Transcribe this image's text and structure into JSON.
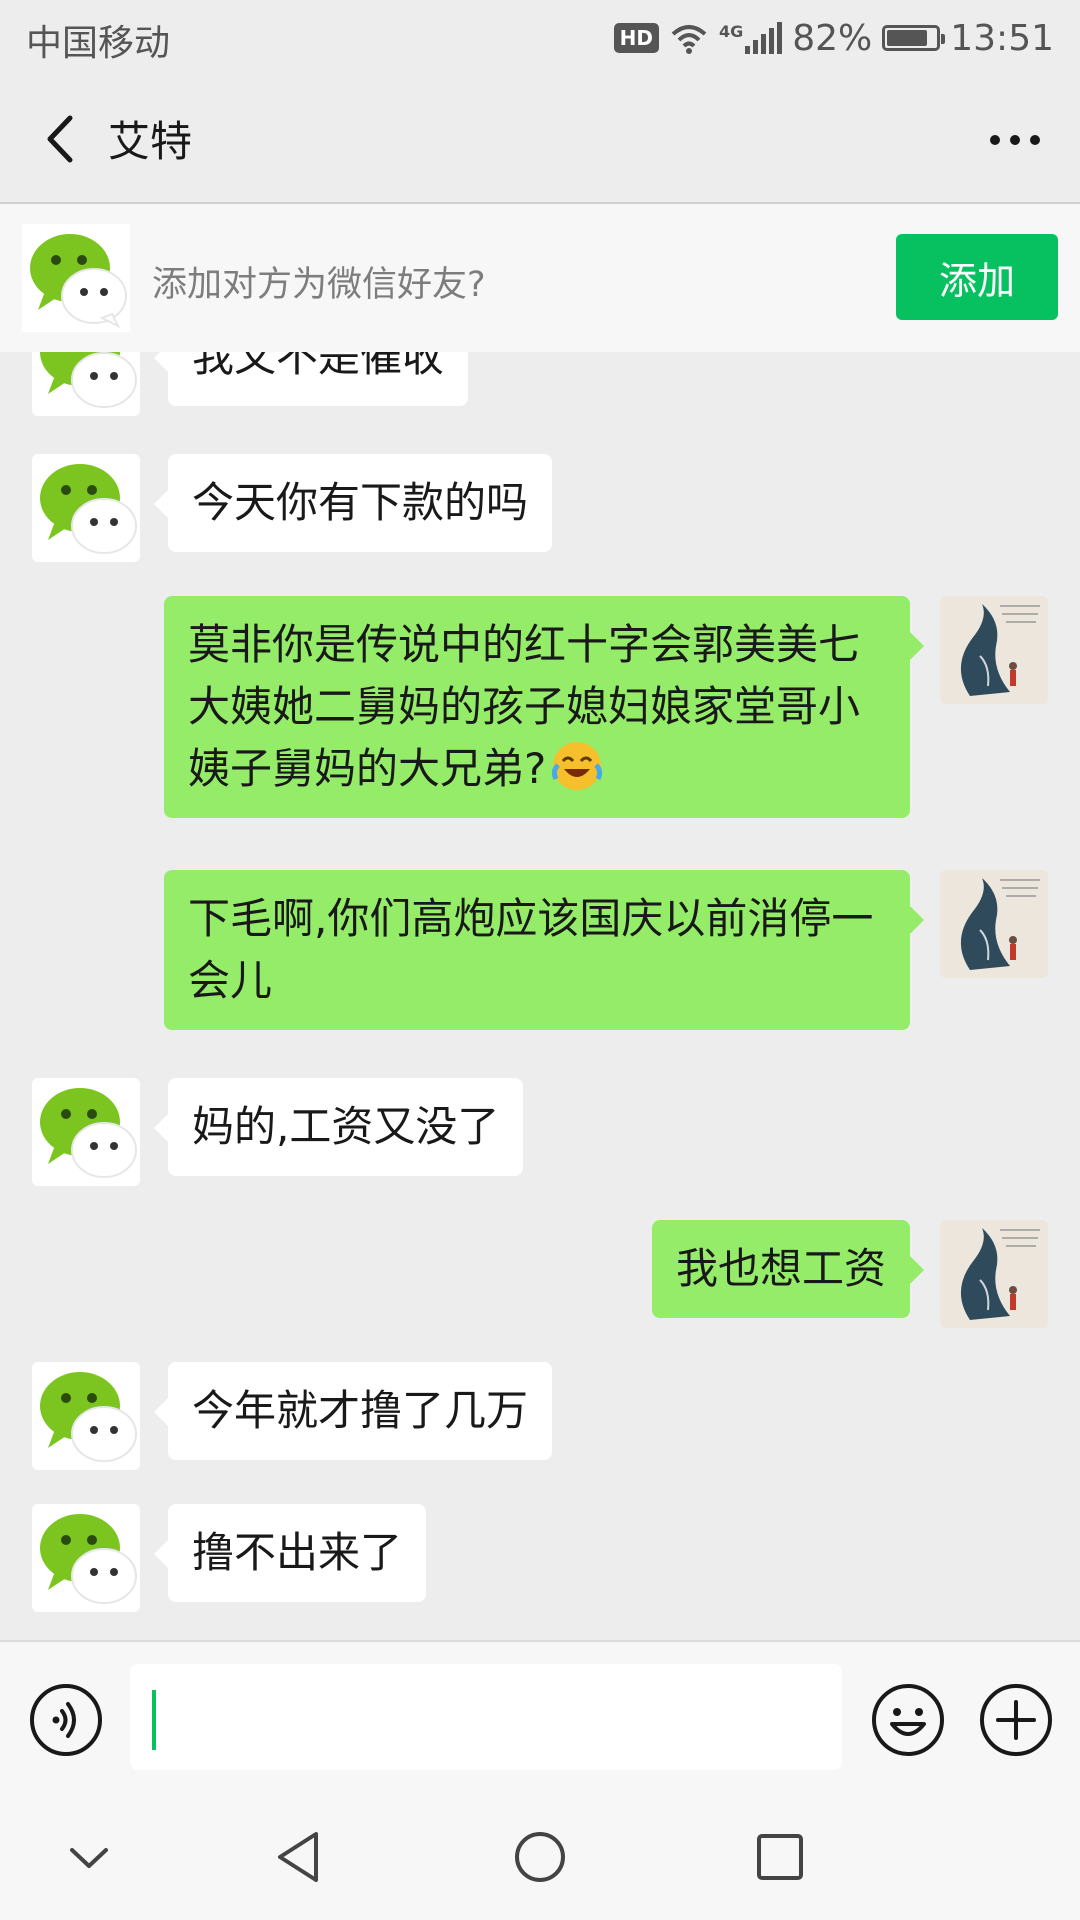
{
  "status_bar": {
    "carrier": "中国移动",
    "hd": "HD",
    "network": "4G",
    "battery_percent": "82%",
    "battery_level": 0.82,
    "time": "13:51"
  },
  "header": {
    "title": "艾特",
    "back_icon": "chevron-left-icon",
    "more_icon": "more-horizontal-icon"
  },
  "add_friend_banner": {
    "prompt": "添加对方为微信好友?",
    "button_label": "添加",
    "button_color": "#07c160"
  },
  "messages": [
    {
      "side": "left",
      "text": "我又不是催收"
    },
    {
      "side": "left",
      "text": "今天你有下款的吗"
    },
    {
      "side": "right",
      "text": "莫非你是传说中的红十字会郭美美七大姨她二舅妈的孩子媳妇娘家堂哥小姨子舅妈的大兄弟?",
      "emoji": "face-with-tears-of-joy"
    },
    {
      "side": "right",
      "text": "下毛啊,你们高炮应该国庆以前消停一会儿"
    },
    {
      "side": "left",
      "text": "妈的,工资又没了"
    },
    {
      "side": "right",
      "text": "我也想工资"
    },
    {
      "side": "left",
      "text": "今年就才撸了几万"
    },
    {
      "side": "left",
      "text": "撸不出来了"
    }
  ],
  "input_bar": {
    "value": "",
    "voice_icon": "voice-icon",
    "emoji_icon": "emoji-icon",
    "plus_icon": "plus-icon"
  },
  "nav_bar": {
    "icons": [
      "chevron-down-icon",
      "back-triangle-icon",
      "home-circle-icon",
      "recents-square-icon"
    ]
  },
  "colors": {
    "background": "#ededed",
    "bubble_self": "#95ec69",
    "bubble_other": "#ffffff",
    "accent": "#07c160"
  }
}
